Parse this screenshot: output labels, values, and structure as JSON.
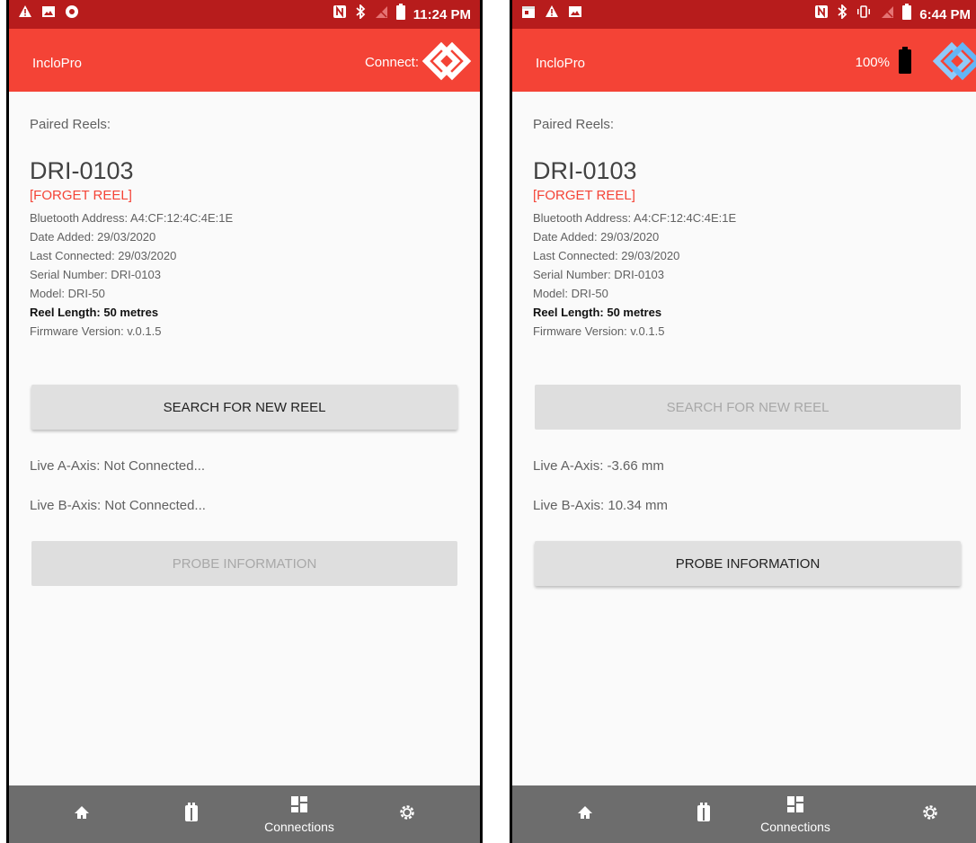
{
  "screens": [
    {
      "status": {
        "time": "11:24 PM"
      },
      "app": {
        "title": "IncloPro",
        "connect_label": "Connect:",
        "battery_pct": ""
      },
      "paired_label": "Paired Reels:",
      "reel": {
        "name": "DRI-0103",
        "forget": "[FORGET REEL]",
        "bluetooth": "Bluetooth Address: A4:CF:12:4C:4E:1E",
        "date_added": "Date Added: 29/03/2020",
        "last_connected": "Last Connected: 29/03/2020",
        "serial": "Serial Number: DRI-0103",
        "model": "Model: DRI-50",
        "length": "Reel Length: 50 metres",
        "firmware": "Firmware Version: v.0.1.5"
      },
      "search_button": "SEARCH FOR NEW REEL",
      "live_a": "Live A-Axis: Not Connected...",
      "live_b": "Live B-Axis: Not Connected...",
      "probe_button": "PROBE INFORMATION",
      "nav": {
        "connections": "Connections"
      }
    },
    {
      "status": {
        "time": "6:44 PM"
      },
      "app": {
        "title": "IncloPro",
        "connect_label": "",
        "battery_pct": "100%"
      },
      "paired_label": "Paired Reels:",
      "reel": {
        "name": "DRI-0103",
        "forget": "[FORGET REEL]",
        "bluetooth": "Bluetooth Address: A4:CF:12:4C:4E:1E",
        "date_added": "Date Added: 29/03/2020",
        "last_connected": "Last Connected: 29/03/2020",
        "serial": "Serial Number: DRI-0103",
        "model": "Model: DRI-50",
        "length": "Reel Length: 50 metres",
        "firmware": "Firmware Version: v.0.1.5"
      },
      "search_button": "SEARCH FOR NEW REEL",
      "live_a": "Live A-Axis: -3.66 mm",
      "live_b": "Live B-Axis: 10.34 mm",
      "probe_button": "PROBE INFORMATION",
      "nav": {
        "connections": "Connections"
      }
    }
  ],
  "colors": {
    "status_bar": "#b71c1c",
    "app_bar": "#f44336",
    "nav_bar": "#6d6d6d",
    "accent_red": "#f44336"
  },
  "icons": [
    "warning-icon",
    "image-icon",
    "record-icon",
    "nfc-icon",
    "bluetooth-icon",
    "vibrate-icon",
    "no-sim-icon",
    "battery-icon",
    "home-icon",
    "reel-icon",
    "dashboard-icon",
    "settings-icon",
    "incloprologo-icon"
  ]
}
